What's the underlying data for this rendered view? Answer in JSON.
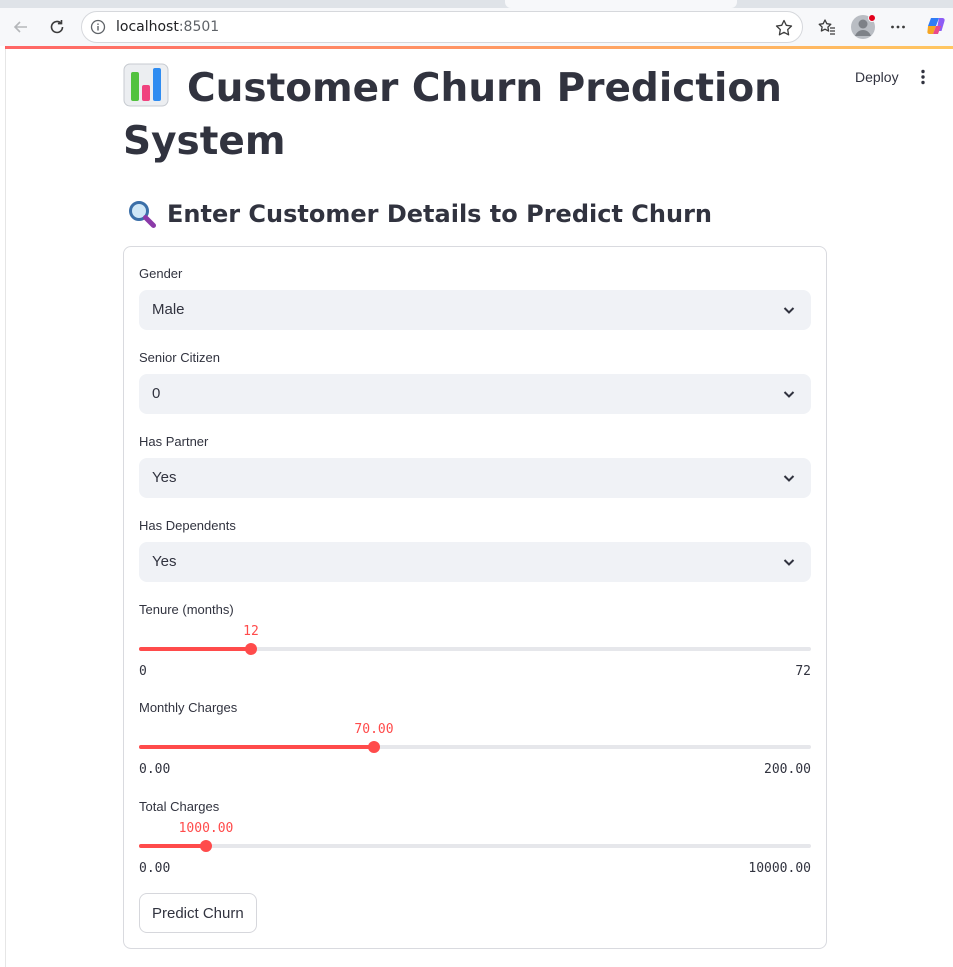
{
  "browser": {
    "url_host": "localhost",
    "url_port": ":8501",
    "icons": [
      "back-arrow-icon",
      "reload-icon",
      "site-info-icon",
      "star-icon",
      "favorites-icon",
      "profile-avatar",
      "more-icon",
      "copilot-icon"
    ]
  },
  "header": {
    "deploy_label": "Deploy",
    "accent_gradient": [
      "#ff4b4b",
      "#ffbd45"
    ]
  },
  "page": {
    "title": "Customer Churn Prediction System",
    "subtitle": "Enter Customer Details to Predict Churn"
  },
  "form": {
    "gender": {
      "label": "Gender",
      "value": "Male"
    },
    "senior_citizen": {
      "label": "Senior Citizen",
      "value": "0"
    },
    "partner": {
      "label": "Has Partner",
      "value": "Yes"
    },
    "dependents": {
      "label": "Has Dependents",
      "value": "Yes"
    },
    "tenure": {
      "label": "Tenure (months)",
      "value": "12",
      "min": "0",
      "max": "72",
      "value_num": 12,
      "min_num": 0,
      "max_num": 72
    },
    "monthly_charges": {
      "label": "Monthly Charges",
      "value": "70.00",
      "min": "0.00",
      "max": "200.00",
      "value_num": 70,
      "min_num": 0,
      "max_num": 200
    },
    "total_charges": {
      "label": "Total Charges",
      "value": "1000.00",
      "min": "0.00",
      "max": "10000.00",
      "value_num": 1000,
      "min_num": 0,
      "max_num": 10000
    },
    "submit_label": "Predict Churn"
  },
  "colors": {
    "primary": "#ff4b4b",
    "text": "#31333f",
    "input_bg": "#f0f2f6"
  }
}
